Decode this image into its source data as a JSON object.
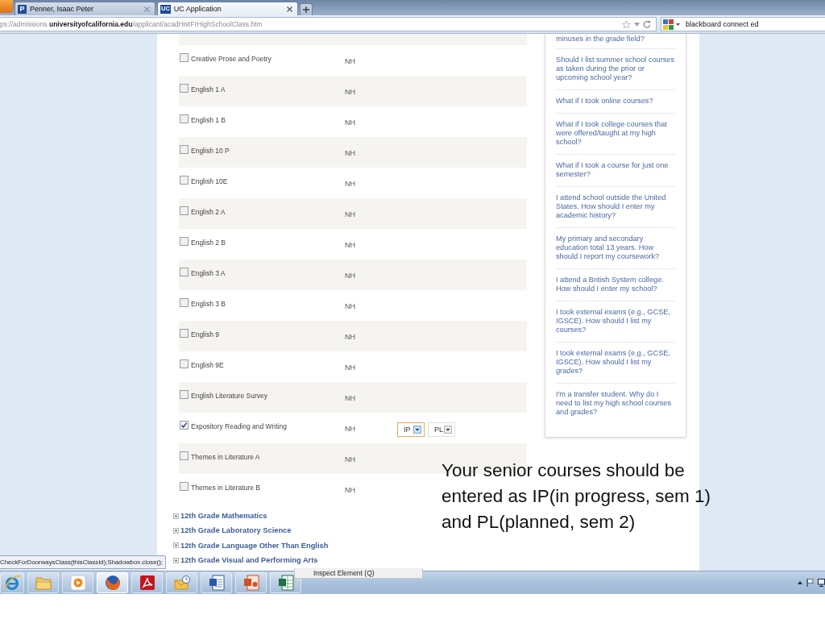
{
  "browser": {
    "tabs": [
      {
        "title": "Penner, Isaac Peter",
        "logo": "P",
        "selected": false
      },
      {
        "title": "UC Application",
        "logo": "UC",
        "selected": true
      }
    ],
    "address": "ps://admissions.**universityofcalifornia.edu**/applicant/acadHistFrHighSchoolClass.htm",
    "search": {
      "value": "blackboard connect ed"
    }
  },
  "courses": [
    {
      "name": "Creative Prose and Poetry",
      "grade": "NH",
      "checked": false
    },
    {
      "name": "English 1 A",
      "grade": "NH",
      "checked": false
    },
    {
      "name": "English 1 B",
      "grade": "NH",
      "checked": false
    },
    {
      "name": "English 10 P",
      "grade": "NH",
      "checked": false
    },
    {
      "name": "English 10E",
      "grade": "NH",
      "checked": false
    },
    {
      "name": "English 2 A",
      "grade": "NH",
      "checked": false
    },
    {
      "name": "English 2 B",
      "grade": "NH",
      "checked": false
    },
    {
      "name": "English 3 A",
      "grade": "NH",
      "checked": false
    },
    {
      "name": "English 3 B",
      "grade": "NH",
      "checked": false
    },
    {
      "name": "English 9",
      "grade": "NH",
      "checked": false
    },
    {
      "name": "English 9E",
      "grade": "NH",
      "checked": false
    },
    {
      "name": "English Literature Survey",
      "grade": "NH",
      "checked": false
    },
    {
      "name": "Expository Reading and Writing",
      "grade": "NH",
      "checked": true,
      "selects": [
        {
          "value": "IP",
          "focused": true
        },
        {
          "value": "PL",
          "focused": false
        }
      ]
    },
    {
      "name": "Themes in Literature A",
      "grade": "NH",
      "checked": false
    },
    {
      "name": "Themes in Literature B",
      "grade": "NH",
      "checked": false
    }
  ],
  "sections": [
    {
      "label": "12th Grade Mathematics",
      "expanded": false
    },
    {
      "label": "12th Grade Laboratory Science",
      "expanded": false
    },
    {
      "label": "12th Grade Language Other Than English",
      "expanded": false
    },
    {
      "label": "12th Grade Visual and Performing Arts",
      "expanded": false
    }
  ],
  "faq": [
    "minuses in the grade field?",
    "Should I list summer school courses as taken during the prior or upcoming school year?",
    "What if I took online courses?",
    "What if I took college courses that were offered/taught at my high school?",
    "What if I took a course for just one semester?",
    "I attend school outside the United States. How should I enter my academic history?",
    "My primary and secondary education total 13 years. How should I report my coursework?",
    "I attend a British System college. How should I enter my school?",
    "I took external exams (e.g., GCSE, IGSCE). How should I list my courses?",
    "I took external exams (e.g., GCSE, IGSCE). How should I list my grades?",
    "I'm a transfer student. Why do I need to list my high school courses and grades?"
  ],
  "status_bar": "CheckForDoorwaysClass(thisClassId);Shadowbox.close();",
  "context_menu": {
    "items": [
      "Inspect Element (Q)"
    ]
  },
  "taskbar": {
    "apps": [
      {
        "kind": "browser",
        "selected": false
      },
      {
        "kind": "folder",
        "selected": false
      },
      {
        "kind": "player",
        "selected": false
      },
      {
        "kind": "globe",
        "selected": true
      },
      {
        "kind": "pdf",
        "selected": false
      },
      {
        "kind": "mail",
        "selected": false
      },
      {
        "kind": "document",
        "selected": false
      },
      {
        "kind": "slides",
        "selected": false
      },
      {
        "kind": "sheet",
        "selected": false
      }
    ]
  },
  "annotation": "Your senior courses should be entered as IP(in progress, sem 1) and PL(planned, sem 2)"
}
